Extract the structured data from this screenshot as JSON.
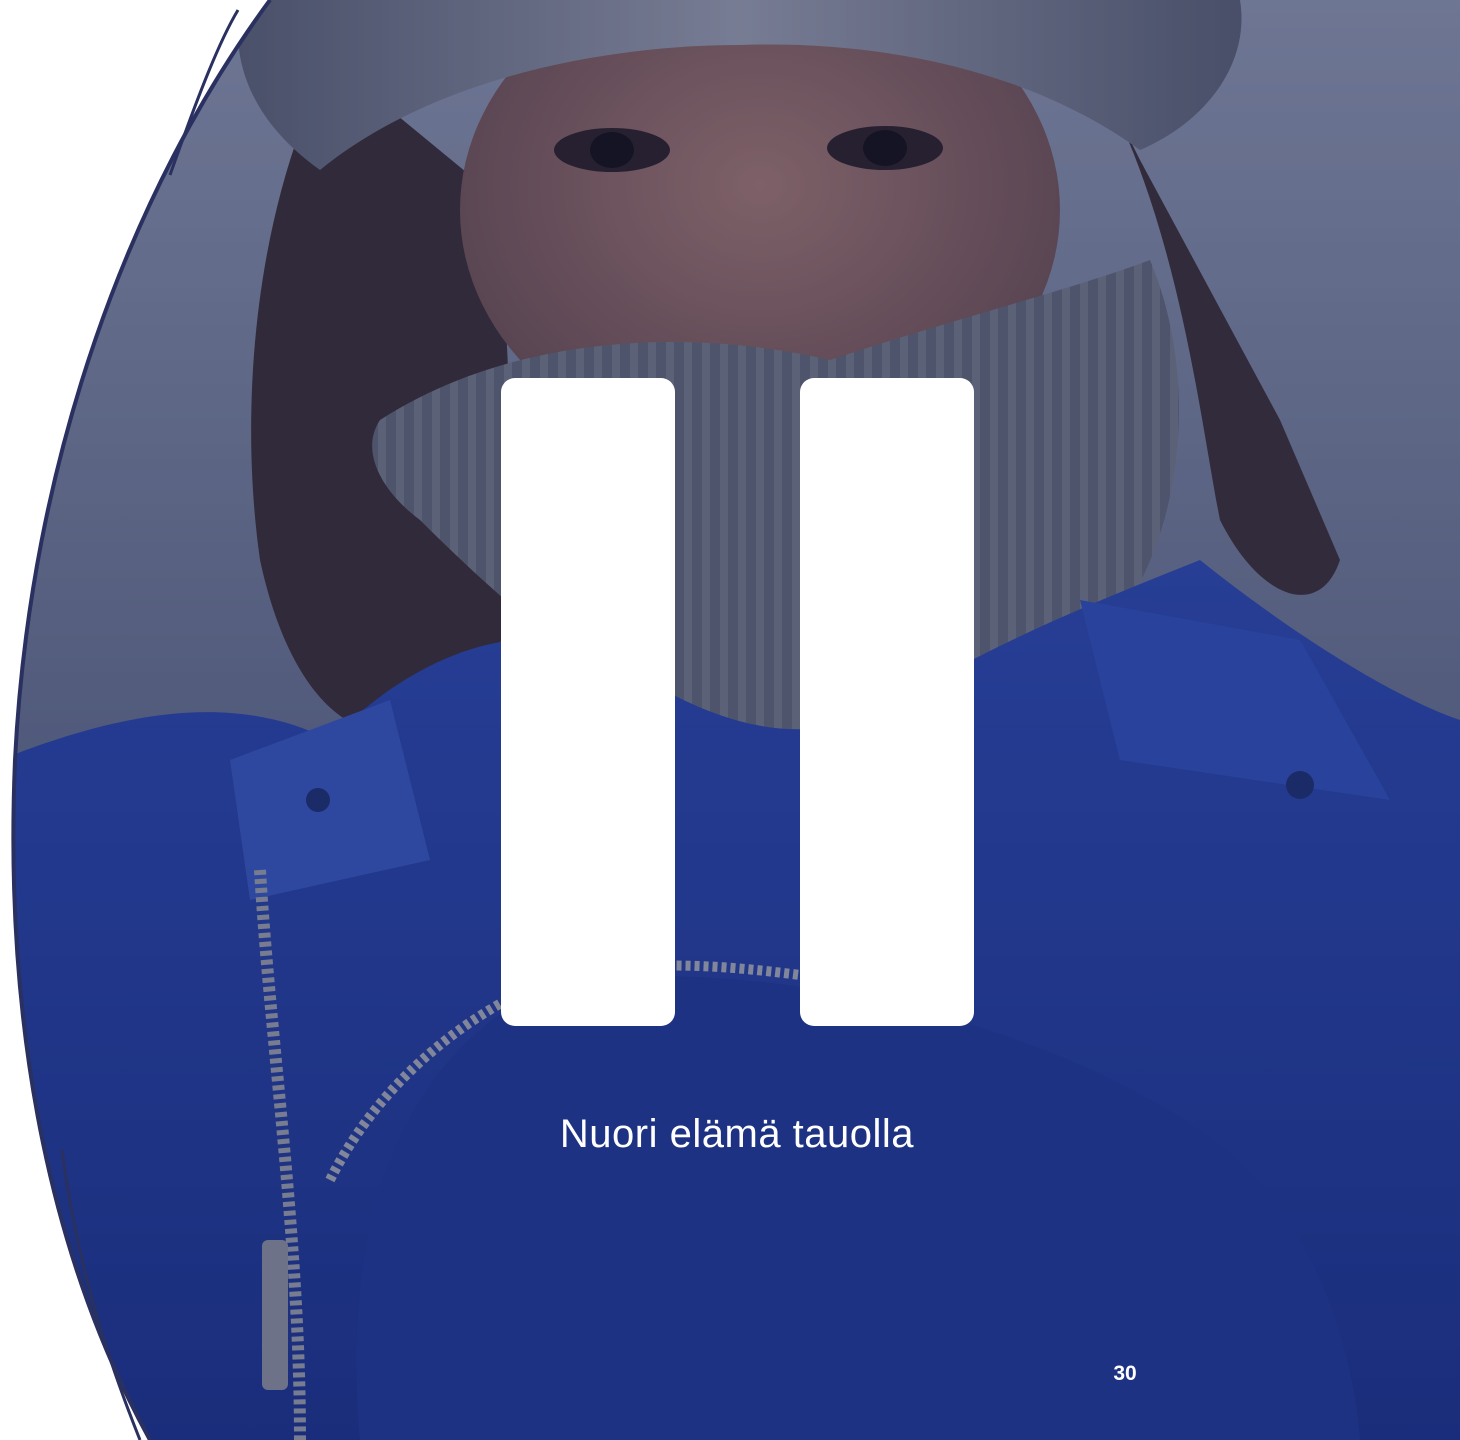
{
  "slide": {
    "caption": "Nuori elämä tauolla",
    "page_number": "30"
  },
  "photo": {
    "subject": "person-in-winter-hat-and-blue-coat",
    "overlay_color": "#1b2a66"
  },
  "icon": {
    "name": "pause-icon",
    "color": "#ffffff"
  },
  "colors": {
    "coat_blue": "#1f3a9e",
    "scarf_gray": "#6b6d73",
    "background_haze": "#8a93a8",
    "arc_stroke": "#2a3160"
  }
}
